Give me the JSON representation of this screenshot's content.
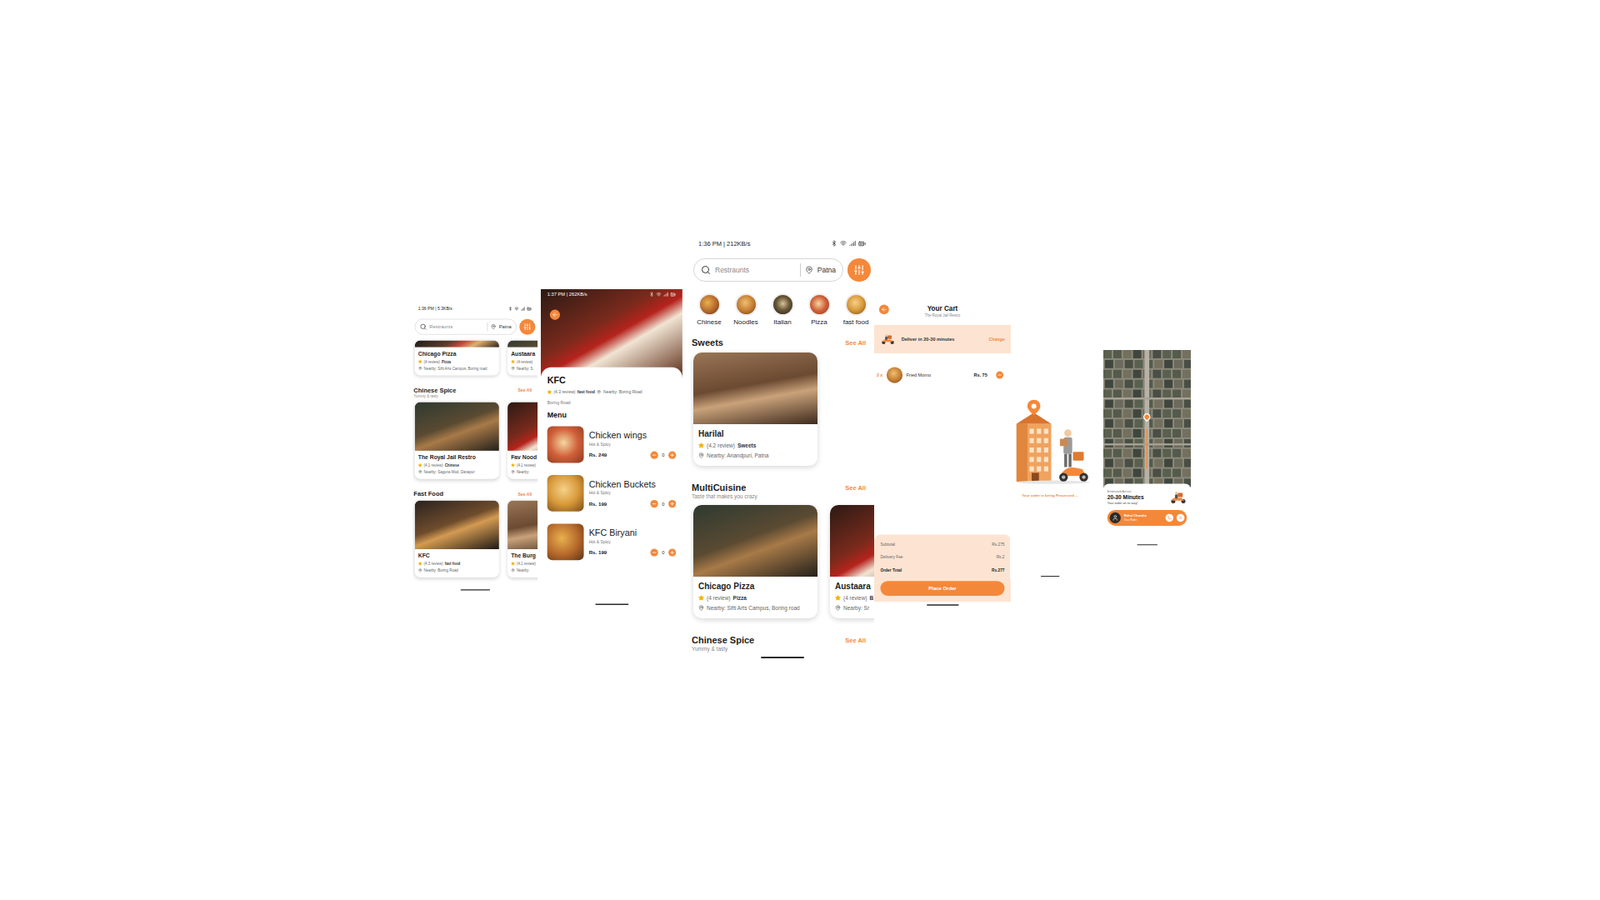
{
  "home_scrolled": {
    "status_bar": {
      "time": "1:36 PM | 5.3KB/s"
    },
    "search": {
      "placeholder": "Restraunts",
      "location": "Patna"
    },
    "top_row": [
      {
        "name": "Chicago Pizza",
        "rating": "(4 review)",
        "category": "Pizza",
        "location": "Nearby: Sifti Arts Campus, Boring road"
      },
      {
        "name": "Austaara",
        "rating": "(4 review)",
        "location": "Nearby: S"
      }
    ],
    "sections": [
      {
        "title": "Chinese Spice",
        "see_all": "See All",
        "subtitle": "Yummy & tasty",
        "cards": [
          {
            "name": "The Royal Jail Restro",
            "rating": "(4.1 review)",
            "category": "Chinese",
            "location": "Nearby: Saguna Mod, Danapur"
          },
          {
            "name": "Fav Nood",
            "rating": "(4.1 review)",
            "location": "Nearby:"
          }
        ]
      },
      {
        "title": "Fast Food",
        "see_all": "See All",
        "cards": [
          {
            "name": "KFC",
            "rating": "(4.3 review)",
            "category": "fast food",
            "location": "Nearby: Boring Road"
          },
          {
            "name": "The Burg",
            "rating": "(4.1 review)",
            "location": "Nearby:"
          }
        ]
      }
    ]
  },
  "menu": {
    "status_bar": {
      "time": "1:37 PM | 262KB/s"
    },
    "restaurant": {
      "name": "KFC",
      "rating": "(4.3 review)",
      "category": "fast food",
      "location": "Nearby: Boring Road",
      "address": "Boring Road"
    },
    "heading": "Menu",
    "items": [
      {
        "name": "Chicken wings",
        "description": "Hot & Spicy",
        "price": "Rs. 249",
        "quantity": "0"
      },
      {
        "name": "Chicken Buckets",
        "description": "Hot & Spicy",
        "price": "Rs. 199",
        "quantity": "0"
      },
      {
        "name": "KFC Biryani",
        "description": "Hot & Spicy",
        "price": "Rs. 199",
        "quantity": "0"
      }
    ]
  },
  "home": {
    "status_bar": {
      "time": "1:36 PM | 212KB/s"
    },
    "search": {
      "placeholder": "Restraunts",
      "location": "Patna"
    },
    "categories": [
      {
        "label": "Chinese"
      },
      {
        "label": "Noodles"
      },
      {
        "label": "Italian"
      },
      {
        "label": "Pizza"
      },
      {
        "label": "fast food"
      }
    ],
    "sections": [
      {
        "title": "Sweets",
        "see_all": "See All",
        "cards": [
          {
            "name": "Harilal",
            "rating": "(4.2 review)",
            "category": "Sweets",
            "location": "Nearby: Anandpuri, Patna"
          }
        ]
      },
      {
        "title": "MultiCuisine",
        "see_all": "See All",
        "subtitle": "Taste that makes you crazy",
        "cards": [
          {
            "name": "Chicago Pizza",
            "rating": "(4 review)",
            "category": "Pizza",
            "location": "Nearby: Sifti Arts Campus, Boring road"
          },
          {
            "name": "Austaara",
            "rating": "(4 review)",
            "category": "B",
            "location": "Nearby: Sr"
          }
        ]
      },
      {
        "title": "Chinese Spice",
        "see_all": "See All",
        "subtitle": "Yummy & tasty",
        "cards": []
      }
    ]
  },
  "cart": {
    "title": "Your Cart",
    "restaurant": "The Royal Jail Restro",
    "delivery": {
      "text": "Deliver in 20-30 minutes",
      "action": "Change"
    },
    "items": [
      {
        "quantity": "2 x",
        "name": "Fried Momo",
        "price": "Rs. 75"
      }
    ],
    "summary": [
      {
        "label": "Subtotal",
        "value": "Rs.275",
        "kind": "line"
      },
      {
        "label": "Delivery Fee",
        "value": "Rs.2",
        "kind": "line"
      },
      {
        "label": "Order Total",
        "value": "Rs.277",
        "kind": "total"
      }
    ],
    "button": "Place Order"
  },
  "processing": {
    "message": "Your order is being Processed ..."
  },
  "tracking": {
    "eta_label": "Estimated Arrival",
    "eta": "20-30 Minutes",
    "note": "Your order on its way!",
    "rider": {
      "name": "Rahul Chandra",
      "role": "Your Rider"
    }
  }
}
